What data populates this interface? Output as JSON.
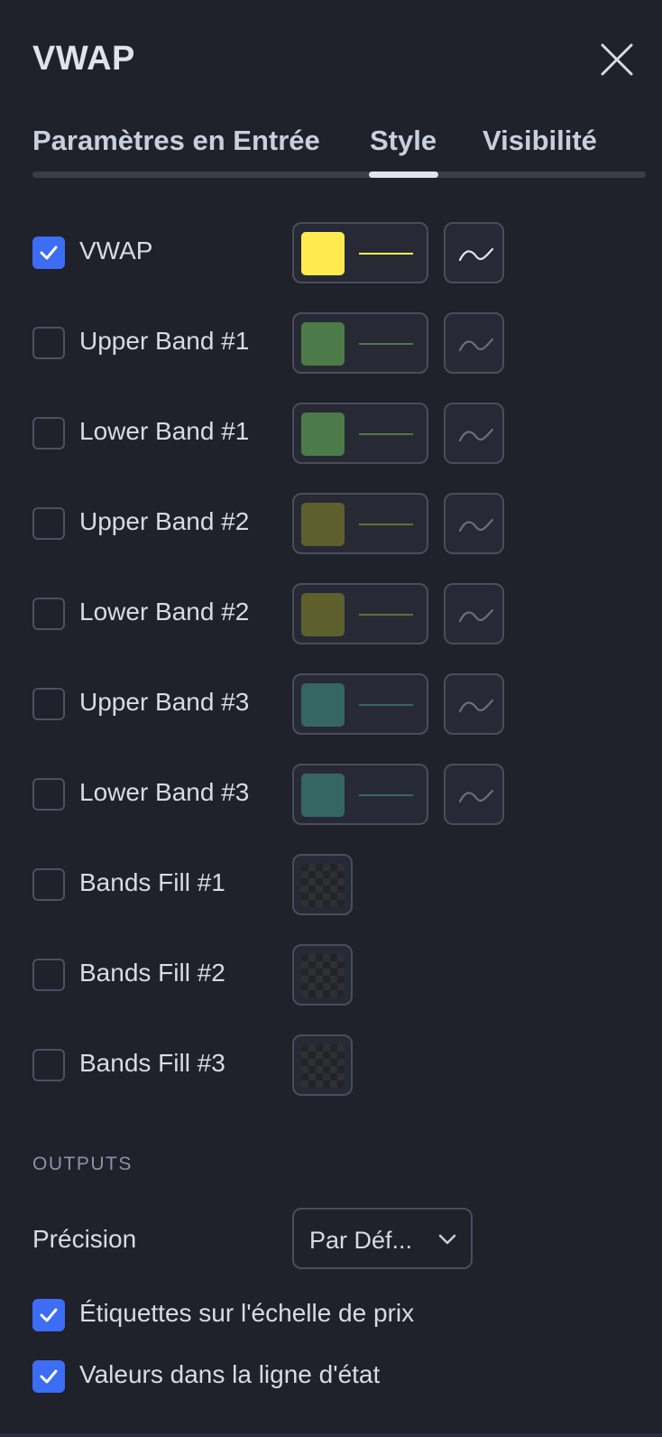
{
  "dialog": {
    "title": "VWAP",
    "close_icon": "close-icon"
  },
  "tabs": [
    {
      "label": "Paramètres en Entrée",
      "active": false
    },
    {
      "label": "Style",
      "active": true
    },
    {
      "label": "Visibilité",
      "active": false
    }
  ],
  "style_rows": [
    {
      "label": "VWAP",
      "checked": true,
      "color": "#ffeb4f",
      "line_color": "#ffeb4f",
      "type": "line"
    },
    {
      "label": "Upper Band #1",
      "checked": false,
      "color": "#4c7a48",
      "line_color": "#4c7a48",
      "type": "line"
    },
    {
      "label": "Lower Band #1",
      "checked": false,
      "color": "#4c7a48",
      "line_color": "#4c7a48",
      "type": "line"
    },
    {
      "label": "Upper Band #2",
      "checked": false,
      "color": "#5f5f2e",
      "line_color": "#6b6b30",
      "type": "line"
    },
    {
      "label": "Lower Band #2",
      "checked": false,
      "color": "#5f5f2e",
      "line_color": "#6b6b30",
      "type": "line"
    },
    {
      "label": "Upper Band #3",
      "checked": false,
      "color": "#356661",
      "line_color": "#356661",
      "type": "line"
    },
    {
      "label": "Lower Band #3",
      "checked": false,
      "color": "#356661",
      "line_color": "#356661",
      "type": "line"
    },
    {
      "label": "Bands Fill #1",
      "checked": false,
      "type": "fill"
    },
    {
      "label": "Bands Fill #2",
      "checked": false,
      "type": "fill"
    },
    {
      "label": "Bands Fill #3",
      "checked": false,
      "type": "fill"
    }
  ],
  "outputs": {
    "section_title": "OUTPUTS",
    "precision_label": "Précision",
    "precision_value": "Par Déf...",
    "price_scale_label": "Étiquettes sur l'échelle de prix",
    "price_scale_checked": true,
    "status_line_label": "Valeurs dans la ligne d'état",
    "status_line_checked": true
  },
  "colors": {
    "background": "#1f212b",
    "accent": "#3d6cf5",
    "border": "#4a4e5b"
  }
}
